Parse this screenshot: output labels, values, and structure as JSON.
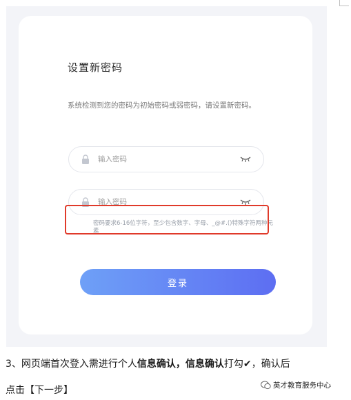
{
  "form": {
    "title": "设置新密码",
    "description": "系统检测到您的密码为初始密码或弱密码，请设置新密码。",
    "password_field_1": {
      "placeholder": "输入密码",
      "value": ""
    },
    "password_field_2": {
      "placeholder": "输入密码",
      "value": ""
    },
    "hint": "密码要求6-16位字符，至少包含数字、字母、_@#.()特殊字符两种元素",
    "login_label": "登录",
    "colors": {
      "accent_start": "#6ea0f7",
      "accent_end": "#5d6ef2",
      "highlight_box": "#e03a2a"
    }
  },
  "instructions": {
    "line1_part1": "3、网页端首次登入需进行个人",
    "line1_bold1": "信息确认",
    "line1_comma": "，",
    "line1_bold2": "信息确认",
    "line1_part2": "打勾",
    "check_mark": "✔",
    "line1_part3": "，确认后",
    "line2": "点击【下一步】"
  },
  "watermark": {
    "text": "英才教育服务中心",
    "icon": "wechat-icon"
  }
}
